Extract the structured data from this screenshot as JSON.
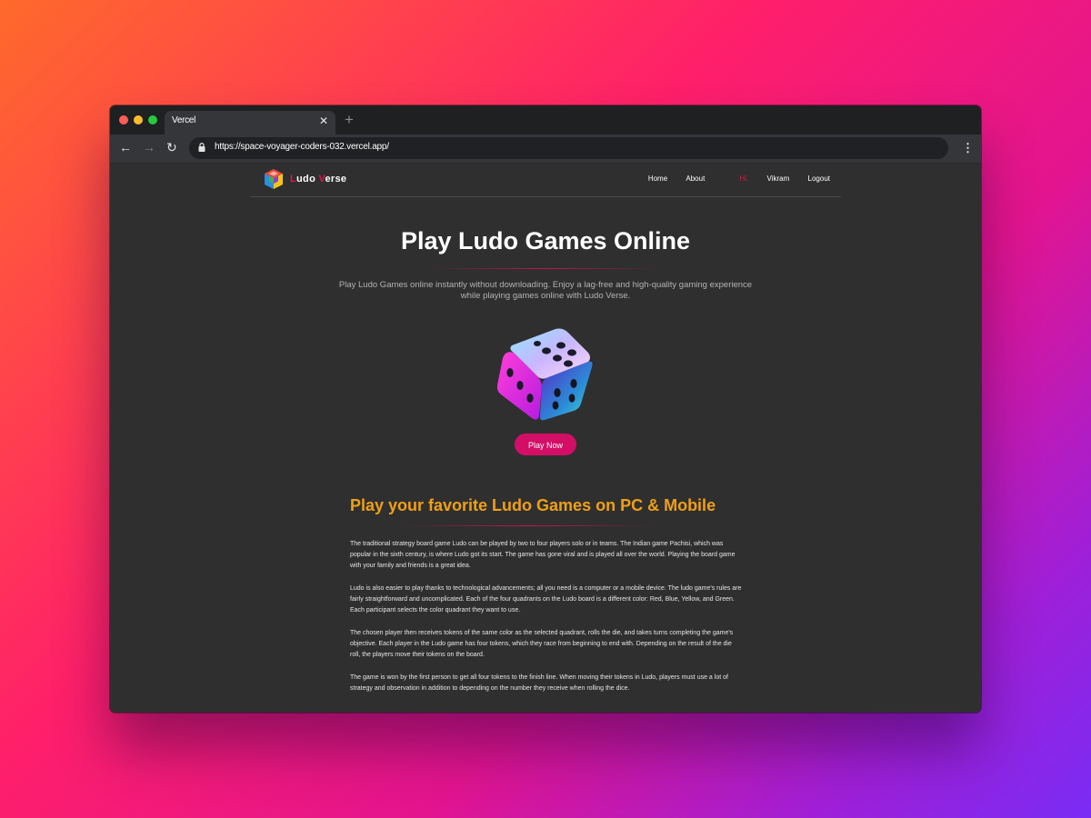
{
  "browser": {
    "tab_title": "Vercel",
    "tab_close": "✕",
    "new_tab": "+",
    "url": "https://space-voyager-coders-032.vercel.app/",
    "back_icon": "←",
    "forward_icon": "→",
    "reload_icon": "↻",
    "menu_icon": "⋮"
  },
  "site": {
    "brand_first_letter": "L",
    "brand_rest_1": "udo ",
    "brand_second_letter": "V",
    "brand_rest_2": "erse",
    "nav": {
      "home": "Home",
      "about": "About",
      "greeting": "Hi,",
      "user": "Vikram",
      "logout": "Logout"
    }
  },
  "hero": {
    "title": "Play Ludo Games Online",
    "description": "Play Ludo Games online instantly without downloading. Enjoy a lag-free and high-quality gaming experience while playing games online with Ludo Verse.",
    "cta": "Play Now"
  },
  "section": {
    "title": "Play your favorite Ludo Games on PC & Mobile",
    "paragraphs": [
      "The traditional strategy board game Ludo can be played by two to four players solo or in teams. The Indian game Pachisi, which was popular in the sixth century, is where Ludo got its start. The game has gone viral and is played all over the world. Playing the board game with your family and friends is a great idea.",
      "Ludo is also easier to play thanks to technological advancements; all you need is a computer or a mobile device. The ludo game's rules are fairly straightforward and uncomplicated. Each of the four quadrants on the Ludo board is a different color: Red, Blue, Yellow, and Green. Each participant selects the color quadrant they want to use.",
      "The chosen player then receives tokens of the same color as the selected quadrant, rolls the die, and takes turns completing the game's objective. Each player in the Ludo game has four tokens, which they race from beginning to end with. Depending on the result of the die roll, the players move their tokens on the board.",
      "The game is won by the first person to get all four tokens to the finish line. When moving their tokens in Ludo, players must use a lot of strategy and observation in addition to depending on the number they receive when rolling the dice."
    ]
  },
  "colors": {
    "accent": "#d30e66",
    "section_title": "#f0a014",
    "page_bg": "#2f2f2f"
  }
}
